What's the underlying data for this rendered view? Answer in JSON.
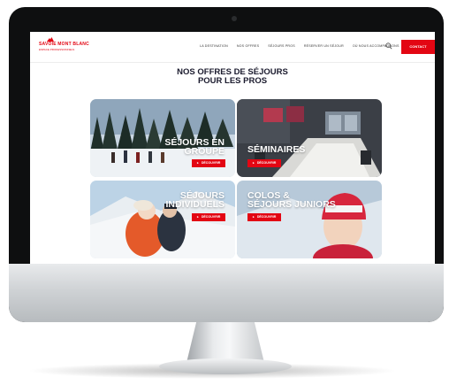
{
  "brand": {
    "name": "SAVOIE MONT BLANC",
    "tagline": "ESPACE PROFESSIONNELS",
    "accent": "#e30613"
  },
  "nav": {
    "items": [
      "LA DESTINATION",
      "NOS OFFRES",
      "SÉJOURS PROS",
      "RÉSERVER UN SÉJOUR",
      "OÙ NOUS ACCOMPAGNONS"
    ],
    "search_icon": "search-icon",
    "contact_label": "CONTACT"
  },
  "hero": {
    "line1": "NOS OFFRES DE SÉJOURS",
    "line2": "POUR LES PROS"
  },
  "cards": [
    {
      "line1": "SÉJOURS EN",
      "line2": "GROUPE",
      "cta": "DÉCOUVRIR"
    },
    {
      "line1": "SÉMINAIRES",
      "line2": "",
      "cta": "DÉCOUVRIR"
    },
    {
      "line1": "SÉJOURS",
      "line2": "INDIVIDUELS",
      "cta": "DÉCOUVRIR"
    },
    {
      "line1": "COLOS &",
      "line2": "SÉJOURS JUNIORS",
      "cta": "DÉCOUVRIR"
    }
  ]
}
